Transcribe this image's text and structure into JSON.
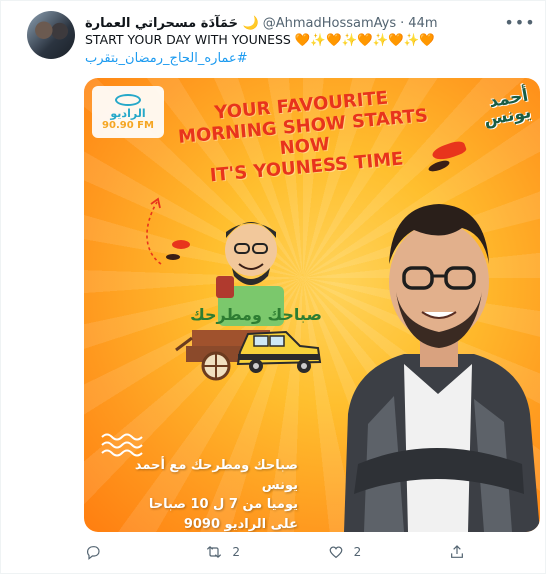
{
  "tweet": {
    "display_name": "حَمَآدَة مسحراتي العمارة 🌙",
    "handle": "@AhmadHossamAys",
    "separator": "·",
    "time": "44m",
    "more_label": "•••",
    "text": "START YOUR DAY WITH YOUNESS 🧡✨🧡✨🧡✨🧡✨🧡",
    "hashtag": "#عماره_الحاج_رمضان_بتقرب"
  },
  "media": {
    "radio_logo_name": "الراديو",
    "radio_logo_freq": "90.90 FM",
    "show_logo": "أحمد يونس",
    "headline": {
      "line1": "YOUR FAVOURITE",
      "line2": "MORNING SHOW STARTS NOW",
      "line3": "IT'S YOUNESS TIME"
    },
    "arabic_lines": [
      "صباحك ومطرحك مع أحمد يونس",
      "يوميا من 7 ل 10 صباحا",
      "على الراديو 9090"
    ],
    "illustration_text": "صباحك ومطرحك",
    "colors": {
      "background": "#ffb02e",
      "headline": "#e8341c",
      "accent_dark": "#3a1f16"
    }
  },
  "actions": {
    "reply_count": "",
    "retweet_count": "2",
    "like_count": "2"
  },
  "colors": {
    "link": "#1d9bf0",
    "muted": "#536471"
  }
}
